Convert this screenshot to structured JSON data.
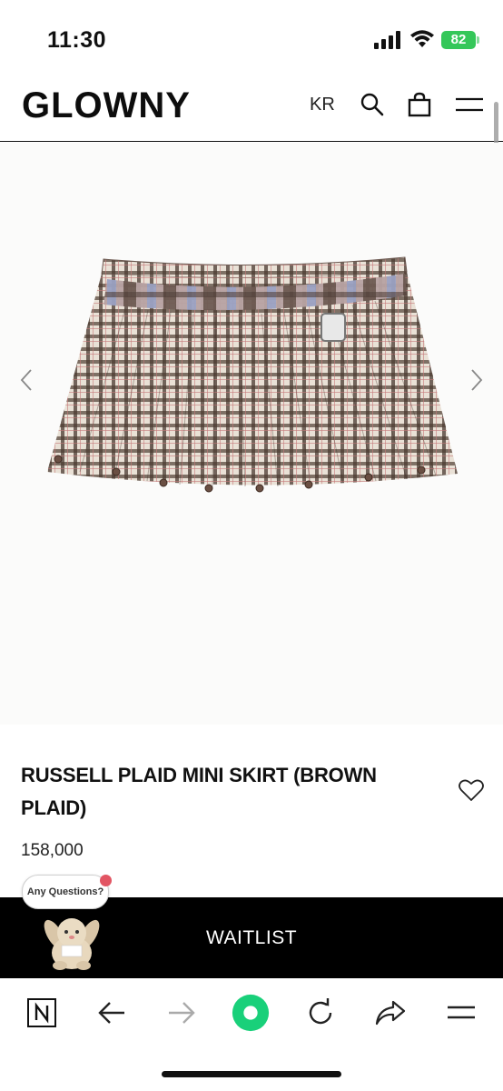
{
  "status_bar": {
    "time": "11:30",
    "battery": "82",
    "battery_color": "#34c759"
  },
  "header": {
    "logo": "GLOWNY",
    "language": "KR",
    "icons": [
      "search-icon",
      "shopping-bag-icon",
      "hamburger-menu-icon"
    ]
  },
  "gallery": {
    "image": "brown plaid pleated mini skirt",
    "prev_icon": "chevron-left-icon",
    "next_icon": "chevron-right-icon"
  },
  "product": {
    "title": "RUSSELL PLAID MINI SKIRT (BROWN PLAID)",
    "price": "158,000",
    "wishlist_icon": "heart-outline-icon"
  },
  "chat_widget": {
    "bubble_text": "Any Questions?",
    "notification_color": "#e25563"
  },
  "cta": {
    "label": "WAITLIST",
    "background": "#000000"
  },
  "browser_toolbar": {
    "items": [
      "naver-n-icon",
      "back-arrow-icon",
      "forward-arrow-icon",
      "home-green-icon",
      "refresh-icon",
      "share-icon",
      "menu-icon"
    ],
    "accent": "#19d07a"
  }
}
